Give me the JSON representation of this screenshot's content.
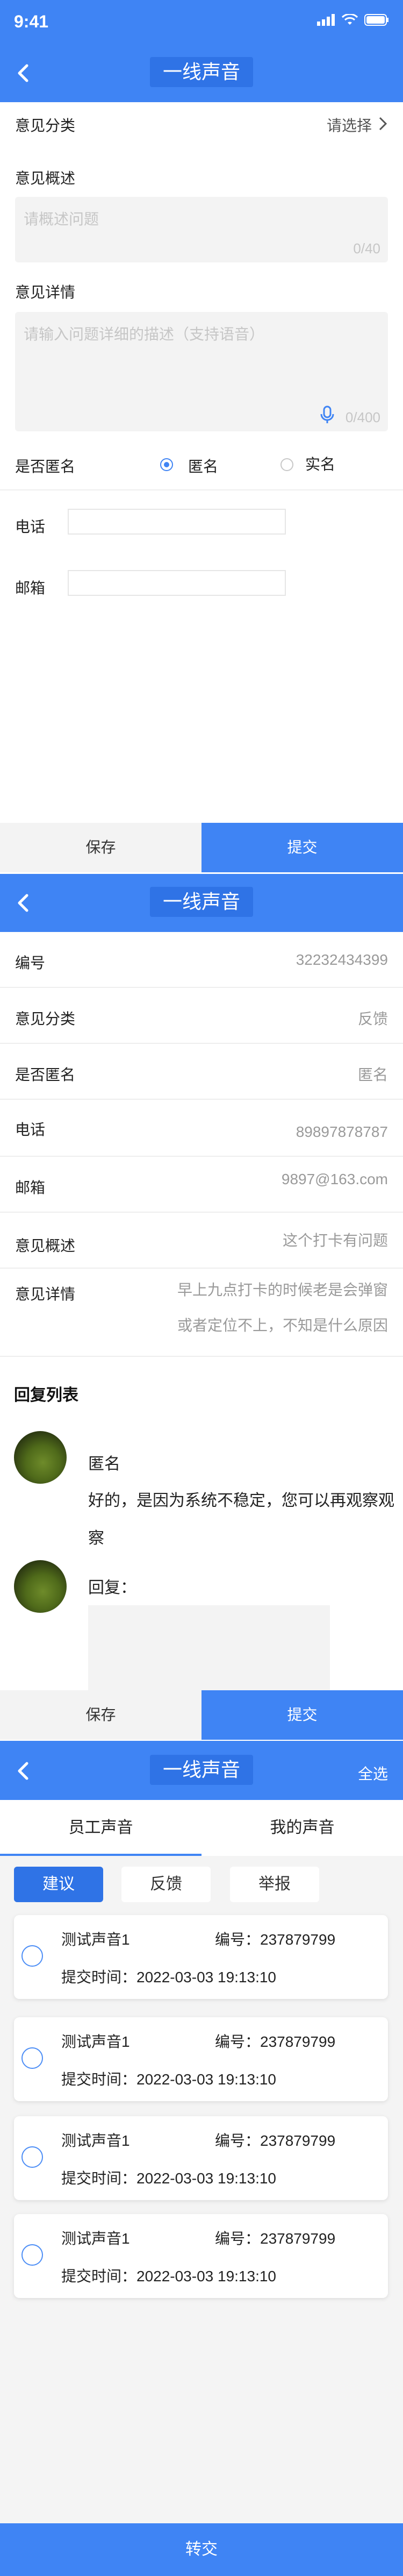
{
  "status_bar": {
    "time": "9:41"
  },
  "screen1": {
    "title": "一线声音",
    "category": {
      "label": "意见分类",
      "value": "请选择"
    },
    "summary": {
      "label": "意见概述",
      "placeholder": "请概述问题",
      "counter": "0/40"
    },
    "detail": {
      "label": "意见详情",
      "placeholder": "请输入问题详细的描述（支持语音）",
      "counter": "0/400"
    },
    "anonymous": {
      "label": "是否匿名",
      "option_anonymous": "匿名",
      "option_realname": "实名",
      "selected": "匿名"
    },
    "phone": {
      "label": "电话",
      "value": ""
    },
    "email": {
      "label": "邮箱",
      "value": ""
    },
    "buttons": {
      "save": "保存",
      "submit": "提交"
    }
  },
  "screen2": {
    "title": "一线声音",
    "fields": [
      {
        "label": "编号",
        "value": "32232434399"
      },
      {
        "label": "意见分类",
        "value": "反馈"
      },
      {
        "label": "是否匿名",
        "value": "匿名"
      },
      {
        "label": "电话",
        "value": "89897878787"
      },
      {
        "label": "邮箱",
        "value": "9897@163.com"
      },
      {
        "label": "意见概述",
        "value": "这个打卡有问题"
      }
    ],
    "detail": {
      "label": "意见详情",
      "line1": "早上九点打卡的时候老是会弹窗",
      "line2": "或者定位不上，不知是什么原因"
    },
    "replies_title": "回复列表",
    "reply": {
      "name": "匿名",
      "text_line1": "好的，是因为系统不稳定，您可以再观察观",
      "text_line2": "察"
    },
    "reply_input_label": "回复：",
    "buttons": {
      "save": "保存",
      "submit": "提交"
    }
  },
  "screen3": {
    "title": "一线声音",
    "select_all": "全选",
    "tabs": [
      "员工声音",
      "我的声音"
    ],
    "active_tab": "员工声音",
    "filters": [
      "建议",
      "反馈",
      "举报"
    ],
    "active_filter": "建议",
    "items": [
      {
        "name": "测试声音1",
        "number": "编号：237879799",
        "time": "提交时间：2022-03-03  19:13:10"
      },
      {
        "name": "测试声音1",
        "number": "编号：237879799",
        "time": "提交时间：2022-03-03  19:13:10"
      },
      {
        "name": "测试声音1",
        "number": "编号：237879799",
        "time": "提交时间：2022-03-03  19:13:10"
      },
      {
        "name": "测试声音1",
        "number": "编号：237879799",
        "time": "提交时间：2022-03-03  19:13:10"
      }
    ],
    "transfer_button": "转交"
  },
  "colors": {
    "primary": "#3f84f4",
    "primary_dark": "#2f73e6",
    "muted": "#9a9a9a",
    "divider": "#eeeeee"
  }
}
